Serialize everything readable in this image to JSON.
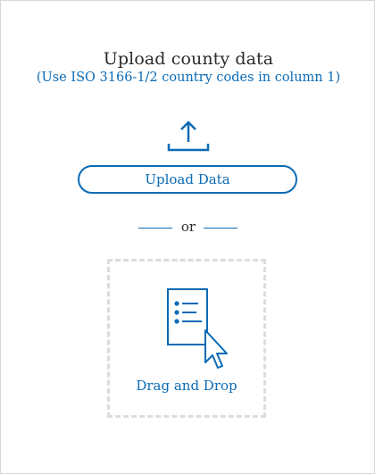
{
  "panel": {
    "title": "Upload county data",
    "subtitle": "(Use ISO 3166-1/2 country codes in column 1)"
  },
  "upload": {
    "icon": "upload-arrow-icon",
    "button_label": "Upload Data"
  },
  "divider": {
    "label": "or"
  },
  "dropzone": {
    "icon": "document-with-cursor-icon",
    "label": "Drag and Drop"
  },
  "colors": {
    "accent": "#0b6bb5",
    "text": "#2b2b2b",
    "border": "#d8d8d8",
    "dashed_border": "#dcdcdc"
  }
}
